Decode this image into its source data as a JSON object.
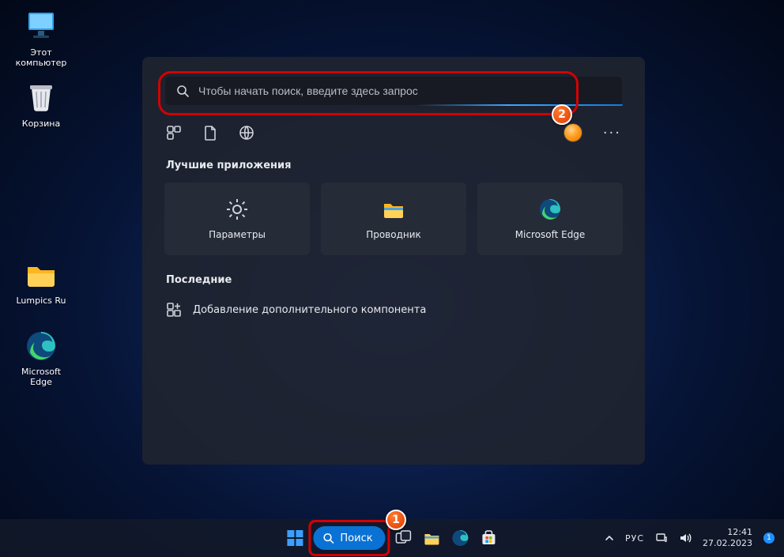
{
  "desktop": {
    "this_pc": "Этот компьютер",
    "recycle_bin": "Корзина",
    "folder": "Lumpics Ru",
    "edge": "Microsoft Edge"
  },
  "search": {
    "placeholder": "Чтобы начать поиск, введите здесь запрос",
    "best_apps_title": "Лучшие приложения",
    "apps": {
      "settings": "Параметры",
      "explorer": "Проводник",
      "edge": "Microsoft Edge"
    },
    "recent_title": "Последние",
    "recent_item_0": "Добавление дополнительного компонента"
  },
  "taskbar": {
    "search_label": "Поиск",
    "lang": "РУС",
    "time": "12:41",
    "date": "27.02.2023",
    "notification_count": "1"
  },
  "annotations": {
    "step1": "1",
    "step2": "2"
  }
}
